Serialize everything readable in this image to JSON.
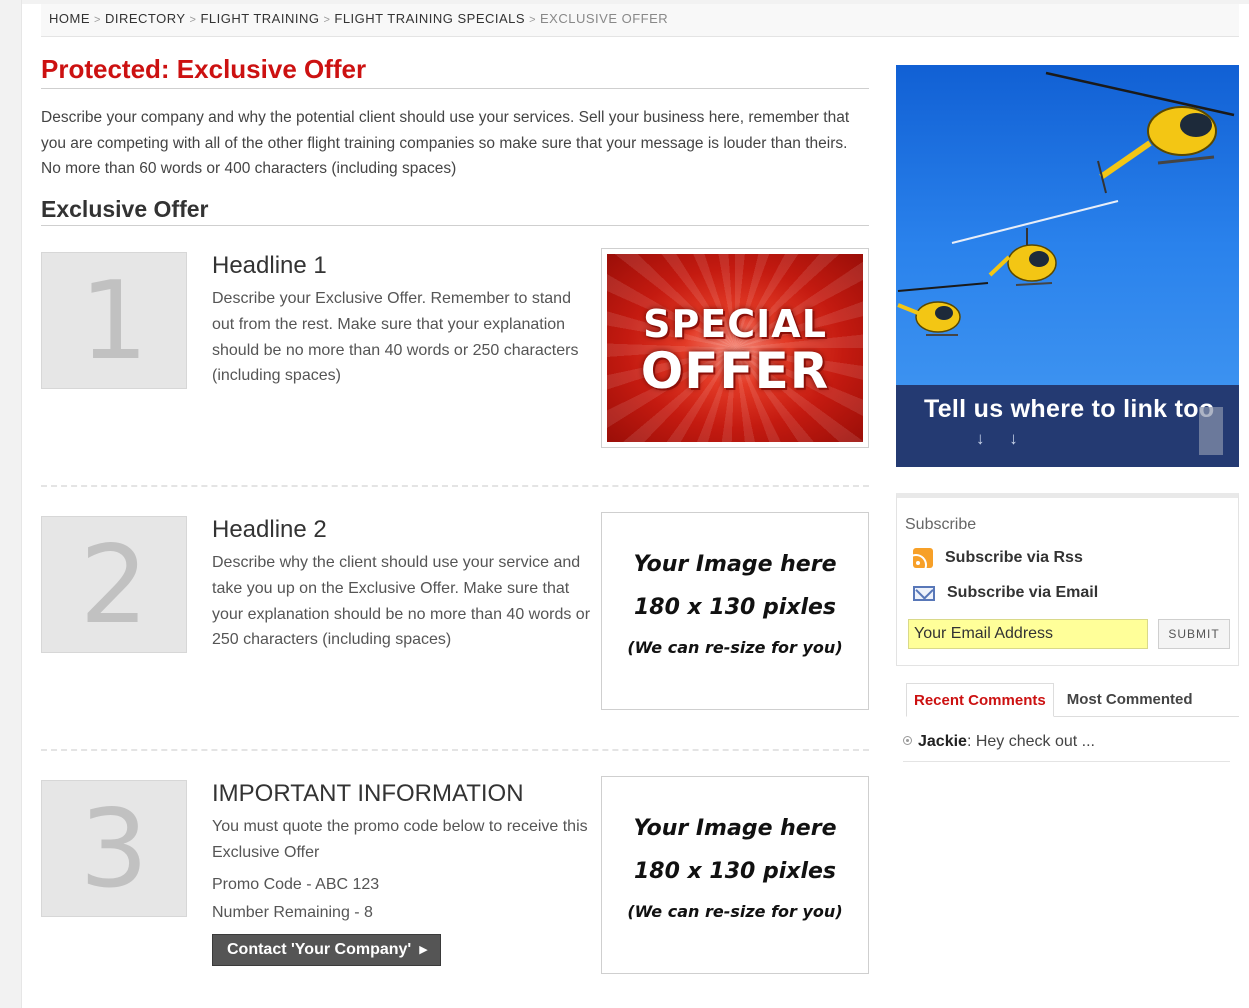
{
  "breadcrumb": {
    "items": [
      "HOME",
      "DIRECTORY",
      "FLIGHT TRAINING",
      "FLIGHT TRAINING SPECIALS"
    ],
    "separator": ">",
    "current": "EXCLUSIVE OFFER"
  },
  "page": {
    "title": "Protected: Exclusive Offer",
    "intro": "Describe your company and why the potential client should use your services. Sell your business here, remember that you are competing with all of the other flight training companies so make sure that your message is louder than theirs. No more than 60 words or 400 characters (including spaces)",
    "section_title": "Exclusive Offer"
  },
  "offers": [
    {
      "number": "1",
      "title": "Headline 1",
      "body": "Describe your Exclusive Offer. Remember to stand out from the rest. Make sure that your explanation should be no more than 40 words or 250 characters (including spaces)",
      "image": {
        "line1": "SPECIAL",
        "line2": "OFFER"
      }
    },
    {
      "number": "2",
      "title": "Headline 2",
      "body": "Describe why the client should use your service and take you up on the Exclusive Offer. Make sure that your explanation should be no more than 40 words or 250 characters (including spaces)",
      "placeholder": {
        "line1": "Your Image here",
        "line2": "180 x 130 pixles",
        "line3": "(We can re-size for you)"
      }
    },
    {
      "number": "3",
      "title": "IMPORTANT INFORMATION",
      "body": "You must quote the promo code below to receive this Exclusive Offer",
      "promo": "Promo Code - ABC 123",
      "remaining": "Number Remaining - 8",
      "button": "Contact 'Your Company'",
      "placeholder": {
        "line1": "Your Image here",
        "line2": "180 x 130 pixles",
        "line3": "(We can re-size for you)"
      }
    }
  ],
  "sidebar": {
    "ad_text": "Tell us where to link too",
    "ad_arrows": "↓ ↓",
    "subscribe": {
      "title": "Subscribe",
      "rss": "Subscribe via Rss",
      "email": "Subscribe via Email",
      "email_value": "Your Email Address",
      "submit": "SUBMIT"
    },
    "tabs": [
      "Recent Comments",
      "Most Commented"
    ],
    "comment": {
      "author": "Jackie",
      "text": ": Hey check out ..."
    }
  },
  "colors": {
    "accent": "#cc1111",
    "input_bg": "#ffff99",
    "ad_band": "#243a72"
  }
}
